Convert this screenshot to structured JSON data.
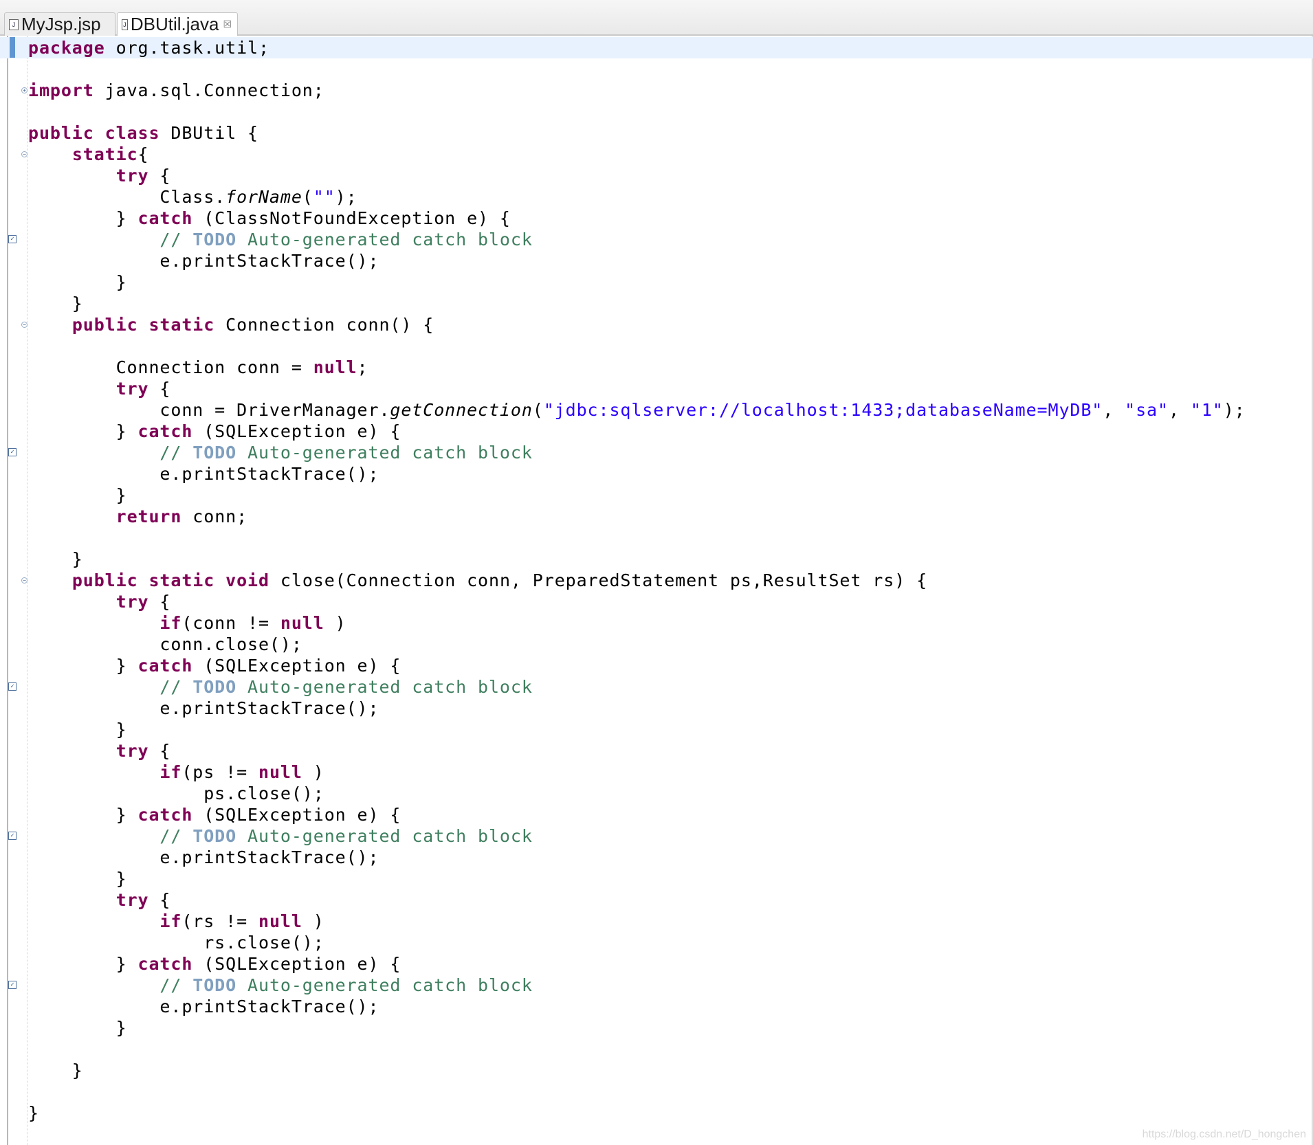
{
  "tabs": [
    {
      "label": "MyJsp.jsp",
      "active": false,
      "icon": "jsp-file-icon"
    },
    {
      "label": "DBUtil.java",
      "active": true,
      "icon": "java-file-icon",
      "close": "☒"
    }
  ],
  "editor": {
    "lines": {
      "l1_a": "package",
      "l1_b": " org.task.util;",
      "l3_a": "import",
      "l3_b": " java.sql.Connection;",
      "l5_a": "public",
      "l5_b": " ",
      "l5_c": "class",
      "l5_d": " DBUtil {",
      "l6_a": "    ",
      "l6_b": "static",
      "l6_c": "{",
      "l7_a": "        ",
      "l7_b": "try",
      "l7_c": " {",
      "l8_a": "            Class.",
      "l8_b": "forName",
      "l8_c": "(",
      "l8_d": "\"\"",
      "l8_e": ");",
      "l9_a": "        } ",
      "l9_b": "catch",
      "l9_c": " (ClassNotFoundException e) {",
      "l10_a": "            // ",
      "l10_b": "TODO",
      "l10_c": " Auto-generated catch block",
      "l11": "            e.printStackTrace();",
      "l12": "        }",
      "l13": "    }",
      "l14_a": "    ",
      "l14_b": "public",
      "l14_c": " ",
      "l14_d": "static",
      "l14_e": " Connection conn() {",
      "l16_a": "        Connection conn = ",
      "l16_b": "null",
      "l16_c": ";",
      "l17_a": "        ",
      "l17_b": "try",
      "l17_c": " {",
      "l18_a": "            conn = DriverManager.",
      "l18_b": "getConnection",
      "l18_c": "(",
      "l18_d": "\"jdbc:sqlserver://localhost:1433;databaseName=MyDB\"",
      "l18_e": ", ",
      "l18_f": "\"sa\"",
      "l18_g": ", ",
      "l18_h": "\"1\"",
      "l18_i": ");",
      "l19_a": "        } ",
      "l19_b": "catch",
      "l19_c": " (SQLException e) {",
      "l20_a": "            // ",
      "l20_b": "TODO",
      "l20_c": " Auto-generated catch block",
      "l21": "            e.printStackTrace();",
      "l22": "        }",
      "l23_a": "        ",
      "l23_b": "return",
      "l23_c": " conn;",
      "l25": "    }",
      "l26_a": "    ",
      "l26_b": "public",
      "l26_c": " ",
      "l26_d": "static",
      "l26_e": " ",
      "l26_f": "void",
      "l26_g": " close(Connection conn, PreparedStatement ps,ResultSet rs) {",
      "l27_a": "        ",
      "l27_b": "try",
      "l27_c": " {",
      "l28_a": "            ",
      "l28_b": "if",
      "l28_c": "(conn != ",
      "l28_d": "null",
      "l28_e": " )",
      "l29": "            conn.close();",
      "l30_a": "        } ",
      "l30_b": "catch",
      "l30_c": " (SQLException e) {",
      "l31_a": "            // ",
      "l31_b": "TODO",
      "l31_c": " Auto-generated catch block",
      "l32": "            e.printStackTrace();",
      "l33": "        }",
      "l34_a": "        ",
      "l34_b": "try",
      "l34_c": " {",
      "l35_a": "            ",
      "l35_b": "if",
      "l35_c": "(ps != ",
      "l35_d": "null",
      "l35_e": " )",
      "l36": "                ps.close();",
      "l37_a": "        } ",
      "l37_b": "catch",
      "l37_c": " (SQLException e) {",
      "l38_a": "            // ",
      "l38_b": "TODO",
      "l38_c": " Auto-generated catch block",
      "l39": "            e.printStackTrace();",
      "l40": "        }",
      "l41_a": "        ",
      "l41_b": "try",
      "l41_c": " {",
      "l42_a": "            ",
      "l42_b": "if",
      "l42_c": "(rs != ",
      "l42_d": "null",
      "l42_e": " )",
      "l43": "                rs.close();",
      "l44_a": "        } ",
      "l44_b": "catch",
      "l44_c": " (SQLException e) {",
      "l45_a": "            // ",
      "l45_b": "TODO",
      "l45_c": " Auto-generated catch block",
      "l46": "            e.printStackTrace();",
      "l47": "        }",
      "l49": "    }",
      "l51": "}"
    },
    "gutter_icons": {
      "task": "task-marker-icon",
      "fold": "fold-toggle-icon",
      "collapsed_import": "+"
    }
  },
  "watermark": "https://blog.csdn.net/D_hongchen"
}
